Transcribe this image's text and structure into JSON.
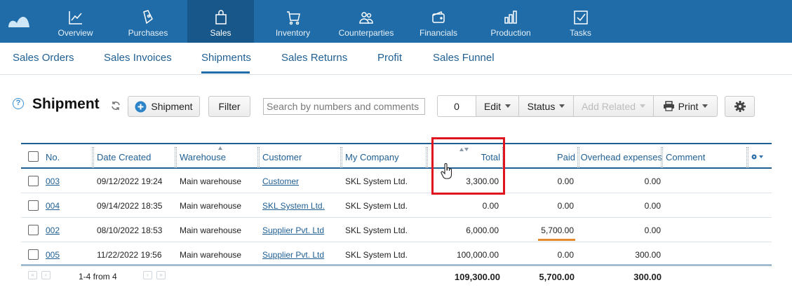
{
  "nav": {
    "items": [
      {
        "label": "Overview",
        "icon": "chart-line-icon"
      },
      {
        "label": "Purchases",
        "icon": "shopping-bag-icon"
      },
      {
        "label": "Sales",
        "icon": "bag-icon",
        "active": true
      },
      {
        "label": "Inventory",
        "icon": "cart-icon"
      },
      {
        "label": "Counterparties",
        "icon": "people-icon"
      },
      {
        "label": "Financials",
        "icon": "wallet-icon"
      },
      {
        "label": "Production",
        "icon": "factory-icon"
      },
      {
        "label": "Tasks",
        "icon": "checkbox-icon"
      }
    ]
  },
  "subnav": {
    "items": [
      "Sales Orders",
      "Sales Invoices",
      "Shipments",
      "Sales Returns",
      "Profit",
      "Sales Funnel"
    ],
    "active": "Shipments"
  },
  "toolbar": {
    "help": "?",
    "title": "Shipment",
    "add_label": "Shipment",
    "filter_label": "Filter",
    "search_placeholder": "Search by numbers and comments",
    "selected_count": "0",
    "edit_label": "Edit",
    "status_label": "Status",
    "add_related_label": "Add Related",
    "print_label": "Print"
  },
  "table": {
    "columns": [
      "No.",
      "Date Created",
      "Warehouse",
      "Customer",
      "My Company",
      "Total",
      "Paid",
      "Overhead expenses",
      "Comment"
    ],
    "rows": [
      {
        "no": "003",
        "date": "09/12/2022 19:24",
        "warehouse": "Main warehouse",
        "customer": "Customer",
        "company": "SKL System Ltd.",
        "total": "3,300.00",
        "paid": "0.00",
        "overhead": "0.00",
        "comment": ""
      },
      {
        "no": "004",
        "date": "09/14/2022 18:35",
        "warehouse": "Main warehouse",
        "customer": "SKL System Ltd.",
        "company": "SKL System Ltd.",
        "total": "0.00",
        "paid": "0.00",
        "overhead": "0.00",
        "comment": ""
      },
      {
        "no": "002",
        "date": "08/10/2022 18:53",
        "warehouse": "Main warehouse",
        "customer": "Supplier Pvt. Ltd",
        "company": "SKL System Ltd.",
        "total": "6,000.00",
        "paid": "5,700.00",
        "overhead": "0.00",
        "comment": ""
      },
      {
        "no": "005",
        "date": "11/22/2022 19:56",
        "warehouse": "Main warehouse",
        "customer": "Supplier Pvt. Ltd",
        "company": "SKL System Ltd.",
        "total": "100,000.00",
        "paid": "0.00",
        "overhead": "300.00",
        "comment": ""
      }
    ],
    "footer": {
      "range": "1-4 from 4",
      "total": "109,300.00",
      "paid": "5,700.00",
      "overhead": "300.00"
    }
  },
  "colors": {
    "nav_bg": "#1f6ca8",
    "nav_active": "#18578a",
    "link": "#1f5f93",
    "highlight": "#e0141e",
    "partial_paid": "#e38b2c"
  }
}
